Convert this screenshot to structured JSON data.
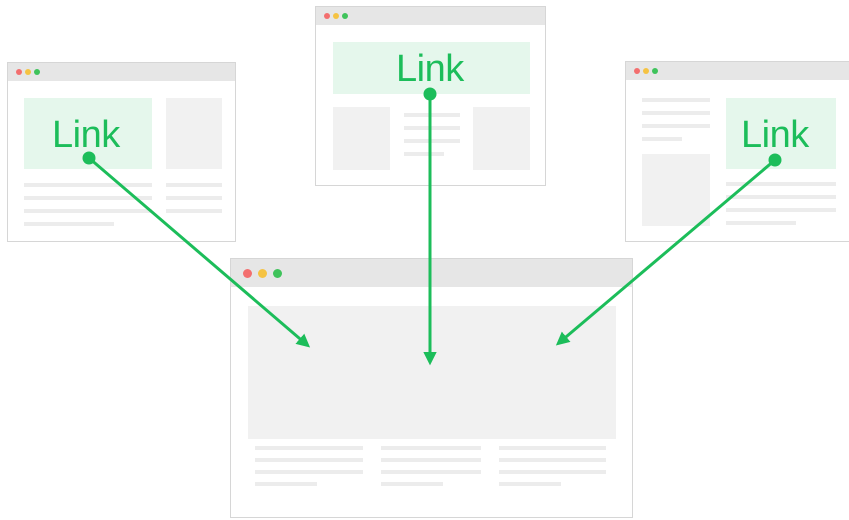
{
  "colors": {
    "accent": "#1cbd5a",
    "link_bg": "#e5f7ec",
    "titlebar": "#e6e6e6",
    "placeholder": "#f1f1f1",
    "border": "#d6d6d6",
    "close": "#f36f6f",
    "minimize": "#f5c343",
    "maximize": "#3fc35b"
  },
  "left_page": {
    "link_label": "Link"
  },
  "center_page": {
    "link_label": "Link"
  },
  "right_page": {
    "link_label": "Link"
  },
  "target_page": {}
}
